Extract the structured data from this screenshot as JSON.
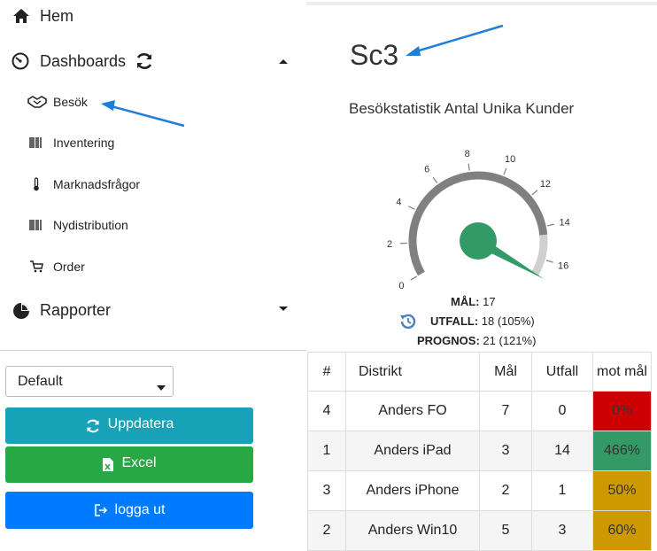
{
  "sidebar": {
    "items": [
      {
        "label": "Hem",
        "icon": "home-icon"
      },
      {
        "label": "Dashboards",
        "icon": "dashboard-icon"
      },
      {
        "label": "Rapporter",
        "icon": "pie-chart-icon"
      }
    ],
    "dashboards_sub": [
      {
        "label": "Besök",
        "icon": "handshake-icon"
      },
      {
        "label": "Inventering",
        "icon": "barcode-icon"
      },
      {
        "label": "Marknadsfrågor",
        "icon": "thermometer-icon"
      },
      {
        "label": "Nydistribution",
        "icon": "barcode-icon"
      },
      {
        "label": "Order",
        "icon": "cart-icon"
      }
    ],
    "select_value": "Default",
    "buttons": {
      "update": "Uppdatera",
      "excel": "Excel",
      "logout": "logga ut"
    }
  },
  "main": {
    "title": "Sc3",
    "gauge": {
      "title": "Besökstatistik Antal Unika Kunder",
      "min": 0,
      "max": 17,
      "value": 18,
      "ticks": [
        "0",
        "2",
        "4",
        "6",
        "8",
        "10",
        "12",
        "14",
        "16"
      ],
      "mal_label": "MÅL:",
      "mal_value": "17",
      "utfall_label": "UTFALL:",
      "utfall_value": "18 (105%)",
      "prognos_label": "PROGNOS:",
      "prognos_value": "21 (121%)"
    },
    "table": {
      "headers": [
        "#",
        "Distrikt",
        "Mål",
        "Utfall",
        "mot mål"
      ],
      "rows": [
        {
          "num": "4",
          "distrikt": "Anders FO",
          "mal": "7",
          "utfall": "0",
          "mot": "0%",
          "color": "#cc0000"
        },
        {
          "num": "1",
          "distrikt": "Anders iPad",
          "mal": "3",
          "utfall": "14",
          "mot": "466%",
          "color": "#339966"
        },
        {
          "num": "3",
          "distrikt": "Anders iPhone",
          "mal": "2",
          "utfall": "1",
          "mot": "50%",
          "color": "#cc9900"
        },
        {
          "num": "2",
          "distrikt": "Anders Win10",
          "mal": "5",
          "utfall": "3",
          "mot": "60%",
          "color": "#cc9900"
        }
      ]
    }
  },
  "colors": {
    "teal": "#17a2b8",
    "green": "#28a745",
    "blue": "#007bff",
    "gauge_fill": "#339966",
    "arrow": "#1e7fd9"
  }
}
